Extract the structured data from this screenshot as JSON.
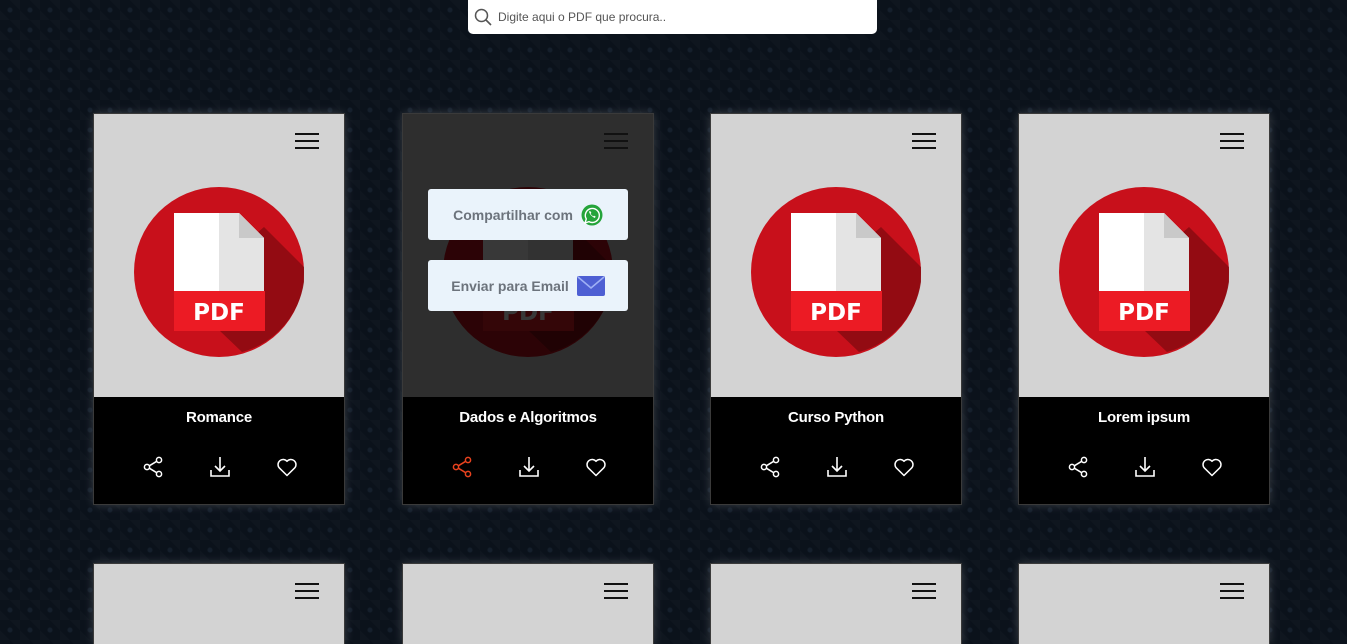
{
  "search": {
    "placeholder": "Digite aqui o PDF que procura.."
  },
  "pdf_badge": "PDF",
  "cards": [
    {
      "title": "Romance"
    },
    {
      "title": "Dados e Algoritmos"
    },
    {
      "title": "Curso Python"
    },
    {
      "title": "Lorem ipsum"
    }
  ],
  "share_menu": {
    "whatsapp_label": "Compartilhar com",
    "email_label": "Enviar para Email"
  },
  "colors": {
    "active_share": "#e8421e",
    "pdf_red": "#c8101b",
    "card_top": "#d3d3d3",
    "whatsapp_green": "#25a43a",
    "email_blue": "#4e5fd3"
  },
  "icons": [
    "search-icon",
    "menu-icon",
    "pdf-file-icon",
    "share-icon",
    "download-icon",
    "heart-icon",
    "whatsapp-icon",
    "email-icon"
  ]
}
